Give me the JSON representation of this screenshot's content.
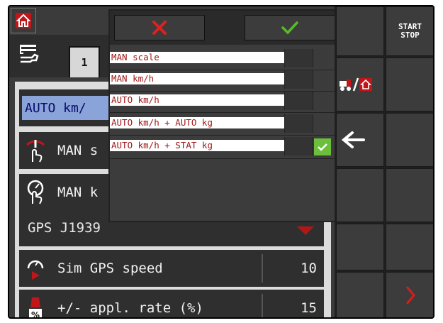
{
  "header": {
    "home_icon": "home-icon",
    "tools_icon": "tools-icon",
    "tab_label": "1"
  },
  "rows": {
    "auto_label": "AUTO km/",
    "man_s_label": "MAN s",
    "man_k_label": "MAN k",
    "gps_label": "GPS J1939",
    "sim_label": "Sim GPS speed",
    "sim_value": "10",
    "rate_label": "+/- appl. rate (%)",
    "rate_value": "15"
  },
  "dialog": {
    "cancel_icon": "x-icon",
    "confirm_icon": "checkmark-icon",
    "options": [
      "MAN scale",
      "MAN km/h",
      "AUTO km/h",
      "AUTO km/h + AUTO kg",
      "AUTO km/h + STAT kg"
    ],
    "selected_index": 4
  },
  "sidebar": {
    "start_label": "START",
    "stop_label": "STOP",
    "tractor_home_icon": "tractor-home-icon",
    "back_arrow_icon": "arrow-left-icon",
    "next_icon": "chevron-right-icon"
  },
  "colors": {
    "selection_highlight": "#8aa3d8",
    "option_text": "#a01818",
    "check_green": "#6bbf3b",
    "cancel_red": "#e02020",
    "accent_red": "#b01818"
  }
}
